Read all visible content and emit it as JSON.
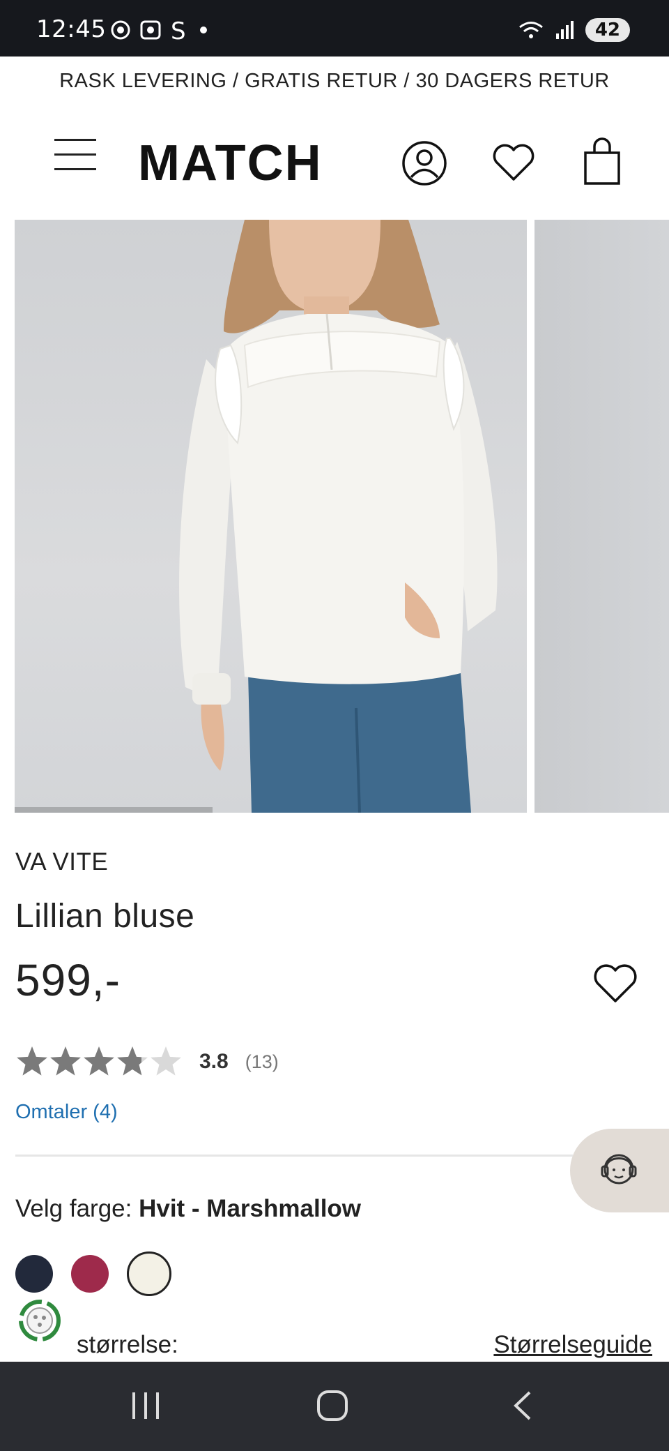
{
  "status_bar": {
    "time": "12:45",
    "battery": "42"
  },
  "promo": {
    "text": "RASK LEVERING / GRATIS RETUR / 30 DAGERS RETUR"
  },
  "header": {
    "logo": "MATCH"
  },
  "product": {
    "brand": "VA VITE",
    "title": "Lillian bluse",
    "price": "599,-",
    "rating_value": "3.8",
    "rating_count": "(13)",
    "rating_stars": 3.8,
    "reviews_link": "Omtaler (4)"
  },
  "color_selector": {
    "label": "Velg farge:",
    "selected": "Hvit - Marshmallow",
    "swatches": [
      {
        "color": "#22293b"
      },
      {
        "color": "#9e2a4b"
      },
      {
        "color": "#f3f1e6"
      }
    ]
  },
  "size": {
    "label": "størrelse:",
    "guide_link": "Størrelseguide"
  },
  "colors": {
    "accent_link": "#1f6fb0",
    "status_bar": "#16181d",
    "nav_bar": "#2a2c31",
    "chat_fab": "#e2dcd6"
  }
}
